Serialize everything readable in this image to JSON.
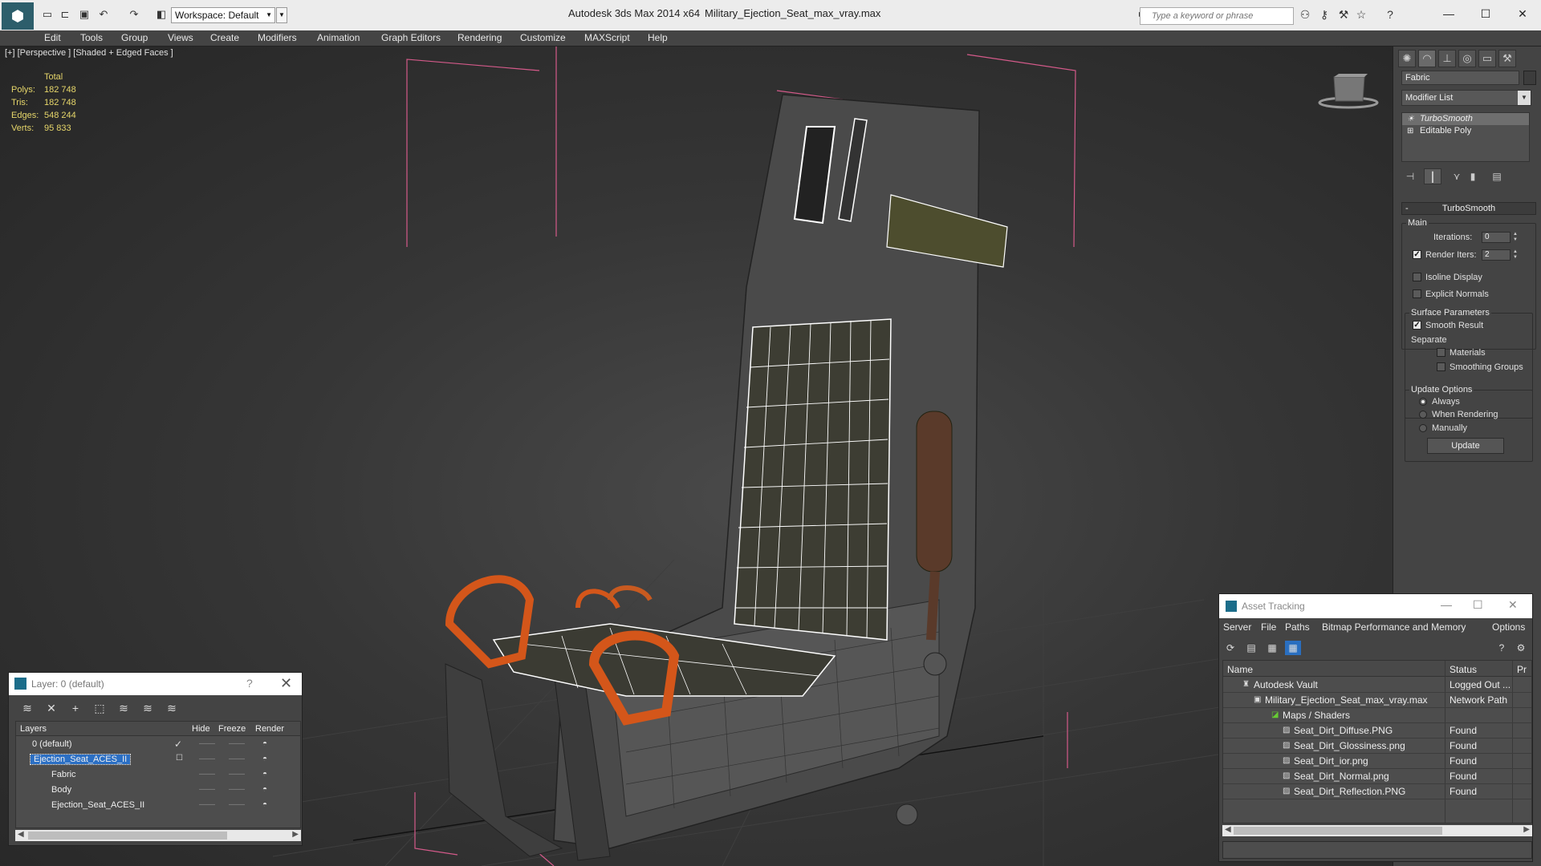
{
  "title_bar": {
    "workspace_label": "Workspace: Default",
    "app_name": "Autodesk 3ds Max  2014 x64",
    "file_name": "Military_Ejection_Seat_max_vray.max",
    "search_placeholder": "Type a keyword or phrase",
    "quick_access_icons": [
      "new-file-icon",
      "open-file-icon",
      "save-icon",
      "undo-icon",
      "redo-icon",
      "project-folder-icon"
    ],
    "help_icons": [
      "binoculars-icon",
      "key-icon",
      "tools-icon",
      "star-icon",
      "help-icon"
    ],
    "window_controls": [
      "minimize-icon",
      "maximize-icon",
      "close-icon"
    ]
  },
  "menu": [
    "Edit",
    "Tools",
    "Group",
    "Views",
    "Create",
    "Modifiers",
    "Animation",
    "Graph Editors",
    "Rendering",
    "Customize",
    "MAXScript",
    "Help"
  ],
  "viewport": {
    "label": "[+] [Perspective ] [Shaded + Edged Faces ]",
    "stats": {
      "header": "Total",
      "rows": [
        {
          "label": "Polys:",
          "value": "182 748"
        },
        {
          "label": "Tris:",
          "value": "182 748"
        },
        {
          "label": "Edges:",
          "value": "548 244"
        },
        {
          "label": "Verts:",
          "value": "95 833"
        }
      ]
    }
  },
  "command_panel": {
    "tabs": [
      "create-tab-icon",
      "modify-tab-icon",
      "hierarchy-tab-icon",
      "motion-tab-icon",
      "display-tab-icon",
      "utilities-tab-icon"
    ],
    "object_name": "Fabric",
    "modifier_list_label": "Modifier List",
    "stack": [
      "TurboSmooth",
      "Editable Poly"
    ],
    "rollout_title": "TurboSmooth",
    "main_group": "Main",
    "iterations_label": "Iterations:",
    "iterations_value": "0",
    "render_iters_label": "Render Iters:",
    "render_iters_value": "2",
    "isoline_label": "Isoline Display",
    "explicit_normals_label": "Explicit Normals",
    "surface_group": "Surface Parameters",
    "smooth_result_label": "Smooth Result",
    "separate_label": "Separate",
    "materials_label": "Materials",
    "smoothing_groups_label": "Smoothing Groups",
    "update_group": "Update Options",
    "always_label": "Always",
    "when_rendering_label": "When Rendering",
    "manually_label": "Manually",
    "update_button": "Update"
  },
  "layer_dialog": {
    "title": "Layer: 0 (default)",
    "help": "?",
    "columns": [
      "Layers",
      "Hide",
      "Freeze",
      "Render"
    ],
    "rows": [
      {
        "name": "0 (default)",
        "indent": 0,
        "active": true,
        "selected": false
      },
      {
        "name": "Ejection_Seat_ACES_II",
        "indent": 0,
        "active": false,
        "selected": true
      },
      {
        "name": "Fabric",
        "indent": 1,
        "active": false,
        "selected": false
      },
      {
        "name": "Body",
        "indent": 1,
        "active": false,
        "selected": false
      },
      {
        "name": "Ejection_Seat_ACES_II",
        "indent": 1,
        "active": false,
        "selected": false
      }
    ]
  },
  "asset_tracking": {
    "title": "Asset Tracking",
    "menu": [
      "Server",
      "File",
      "Paths",
      "Bitmap Performance and Memory",
      "Options"
    ],
    "columns": [
      "Name",
      "Status",
      "Pr"
    ],
    "rows": [
      {
        "name": "Autodesk Vault",
        "status": "Logged Out ...",
        "indent": 1,
        "icon": "vault-icon"
      },
      {
        "name": "Military_Ejection_Seat_max_vray.max",
        "status": "Network Path",
        "indent": 2,
        "icon": "max-file-icon"
      },
      {
        "name": "Maps / Shaders",
        "status": "",
        "indent": 3,
        "icon": "maps-folder-icon"
      },
      {
        "name": "Seat_Dirt_Diffuse.PNG",
        "status": "Found",
        "indent": 4,
        "icon": "image-file-icon"
      },
      {
        "name": "Seat_Dirt_Glossiness.png",
        "status": "Found",
        "indent": 4,
        "icon": "image-file-icon"
      },
      {
        "name": "Seat_Dirt_ior.png",
        "status": "Found",
        "indent": 4,
        "icon": "image-file-icon"
      },
      {
        "name": "Seat_Dirt_Normal.png",
        "status": "Found",
        "indent": 4,
        "icon": "image-file-icon"
      },
      {
        "name": "Seat_Dirt_Reflection.PNG",
        "status": "Found",
        "indent": 4,
        "icon": "image-file-icon"
      }
    ]
  },
  "colors": {
    "stats_text": "#e6d66a",
    "selection_blue": "#2b6fc4",
    "accent_orange": "#d4561a",
    "bbox_pink": "#d45a8a"
  }
}
